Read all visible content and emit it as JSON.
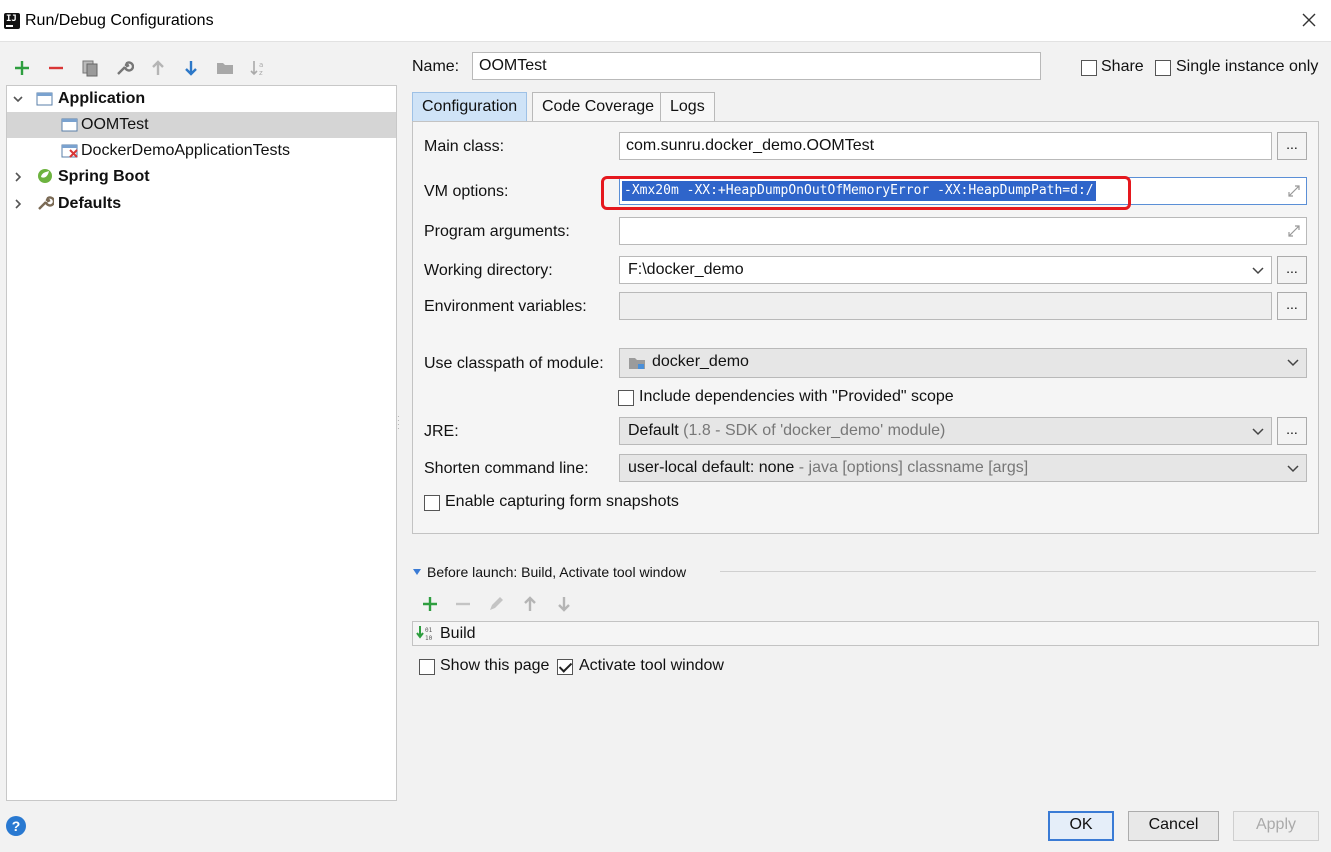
{
  "window": {
    "title": "Run/Debug Configurations"
  },
  "tree": {
    "items": [
      {
        "label": "Application",
        "bold": true
      },
      {
        "label": "OOMTest",
        "selected": true
      },
      {
        "label": "DockerDemoApplicationTests"
      },
      {
        "label": "Spring Boot",
        "bold": true
      },
      {
        "label": "Defaults",
        "bold": true
      }
    ]
  },
  "header": {
    "name_label": "Name:",
    "name_value": "OOMTest",
    "share_label": "Share",
    "single_instance_label": "Single instance only"
  },
  "tabs": [
    {
      "label": "Configuration",
      "active": true
    },
    {
      "label": "Code Coverage"
    },
    {
      "label": "Logs"
    }
  ],
  "config": {
    "main_class_label": "Main class:",
    "main_class_value": "com.sunru.docker_demo.OOMTest",
    "vm_options_label": "VM options:",
    "vm_options_value": "-Xmx20m -XX:+HeapDumpOnOutOfMemoryError -XX:HeapDumpPath=d:/",
    "program_args_label": "Program arguments:",
    "program_args_value": "",
    "working_dir_label": "Working directory:",
    "working_dir_value": "F:\\docker_demo",
    "env_vars_label": "Environment variables:",
    "env_vars_value": "",
    "classpath_label": "Use classpath of module:",
    "classpath_value": "docker_demo",
    "include_deps_label": "Include dependencies with \"Provided\" scope",
    "jre_label": "JRE:",
    "jre_value": "Default",
    "jre_detail": "(1.8 - SDK of 'docker_demo' module)",
    "shorten_label": "Shorten command line:",
    "shorten_value": "user-local default: none",
    "shorten_detail": "- java [options] classname [args]",
    "snapshots_label": "Enable capturing form snapshots",
    "dots": "..."
  },
  "before_launch": {
    "title": "Before launch: Build, Activate tool window",
    "items": [
      "Build"
    ],
    "show_page_label": "Show this page",
    "activate_label": "Activate tool window"
  },
  "buttons": {
    "ok": "OK",
    "cancel": "Cancel",
    "apply": "Apply",
    "help": "?"
  },
  "colors": {
    "accent": "#2f65ca",
    "highlight_box": "#e5181e",
    "add_green": "#2e9e3f",
    "remove_red": "#d93636"
  }
}
